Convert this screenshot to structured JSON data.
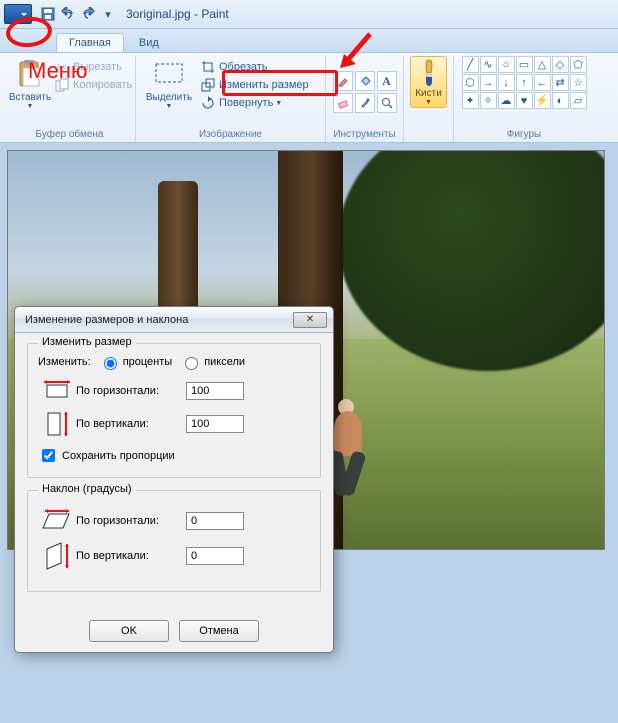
{
  "title": "3original.jpg - Paint",
  "tabs": {
    "home": "Главная",
    "view": "Вид"
  },
  "annotations": {
    "menu": "Меню"
  },
  "clipboard": {
    "paste": "Вставить",
    "cut": "Вырезать",
    "copy": "Копировать",
    "group": "Буфер обмена"
  },
  "image": {
    "select": "Выделить",
    "crop": "Обрезать",
    "resize": "Изменить размер",
    "rotate": "Повернуть",
    "group": "Изображение"
  },
  "tools": {
    "group": "Инструменты"
  },
  "brushes": {
    "label": "Кисти"
  },
  "shapes": {
    "group": "Фигуры"
  },
  "dialog": {
    "title": "Изменение размеров и наклона",
    "resize_legend": "Изменить размер",
    "by_label": "Изменить:",
    "percent": "проценты",
    "pixels": "пиксели",
    "horizontal": "По горизонтали:",
    "vertical": "По вертикали:",
    "h_value": "100",
    "v_value": "100",
    "keep_aspect": "Сохранить пропорции",
    "skew_legend": "Наклон (градусы)",
    "skew_h": "0",
    "skew_v": "0",
    "ok": "OK",
    "cancel": "Отмена"
  }
}
